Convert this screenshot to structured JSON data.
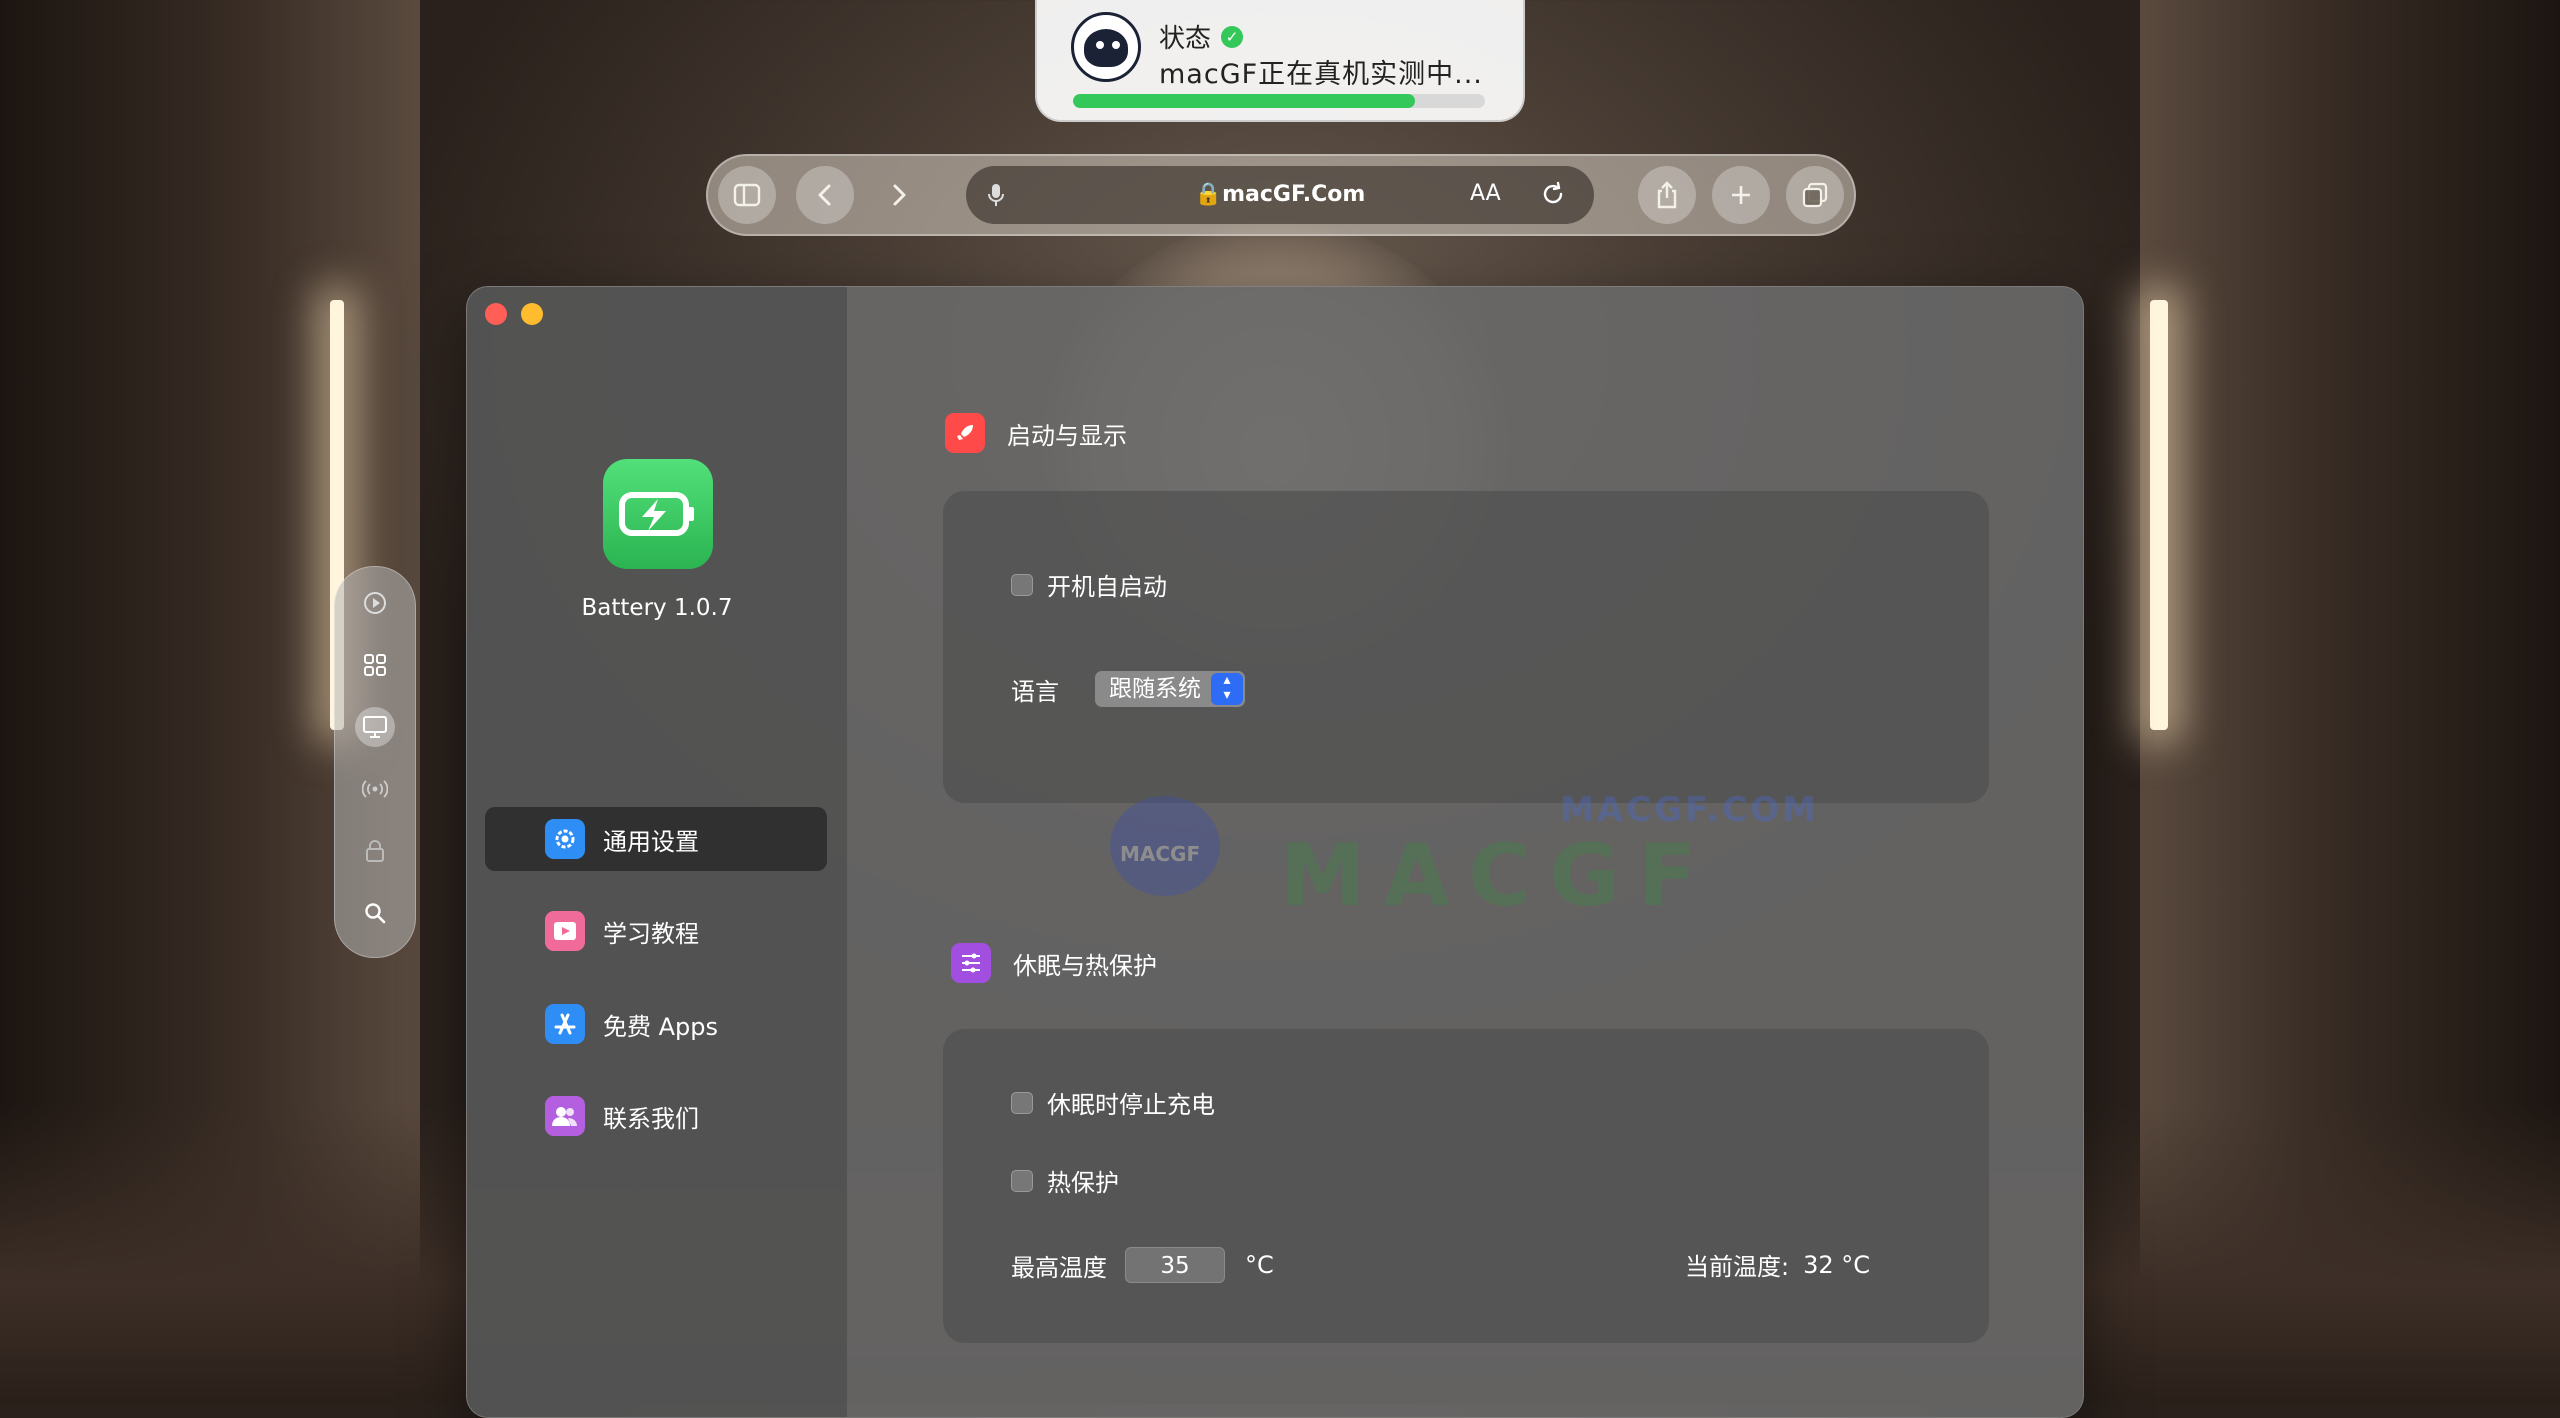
{
  "status": {
    "title": "状态",
    "message": "macGF正在真机实测中...",
    "progress": 0.83
  },
  "browser": {
    "url": "macGF.Com",
    "text_size_label": "AA"
  },
  "app": {
    "name": "Battery 1.0.7",
    "icon": "battery-charging-icon",
    "accent": "#34c759"
  },
  "sidebar": {
    "items": [
      {
        "label": "通用设置",
        "icon": "gear-icon",
        "color": "#2f8ef5",
        "active": true
      },
      {
        "label": "学习教程",
        "icon": "video-icon",
        "color": "#f06b9a",
        "active": false
      },
      {
        "label": "免费 Apps",
        "icon": "app-store-icon",
        "color": "#2f8ef5",
        "active": false
      },
      {
        "label": "联系我们",
        "icon": "people-icon",
        "color": "#b45ee0",
        "active": false
      }
    ]
  },
  "section_startup": {
    "title": "启动与显示",
    "launch_at_login": "开机自启动",
    "language_label": "语言",
    "language_value": "跟随系统"
  },
  "section_sleep": {
    "title": "休眠与热保护",
    "stop_charge_sleep": "休眠时停止充电",
    "thermal_protect": "热保护",
    "max_temp_label": "最高温度",
    "max_temp_value": "35",
    "temp_unit": "°C",
    "current_temp_label": "当前温度:",
    "current_temp_value": "32 °C"
  },
  "watermark": {
    "small": "MACGF.COM",
    "big": "MACGF",
    "badge": "MACGF"
  }
}
